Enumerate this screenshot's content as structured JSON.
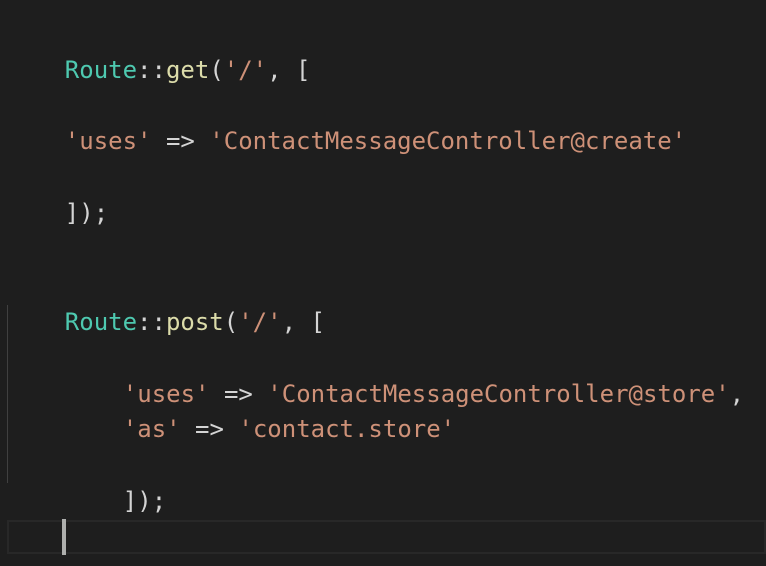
{
  "editor": {
    "lines": [
      {
        "class": "Route",
        "op": "::",
        "method": "get",
        "open": "(",
        "path": "'/'",
        "sep": ", ["
      },
      {
        "key": "'uses'",
        "arrow": " => ",
        "value": "'ContactMessageController@create'"
      },
      {
        "text": "]);"
      },
      {
        "class": "Route",
        "op": "::",
        "method": "post",
        "open": "(",
        "path": "'/'",
        "sep": ", ["
      },
      {
        "key": "'uses'",
        "arrow": " => ",
        "value": "'ContactMessageController@store'",
        "trail": ","
      },
      {
        "key": "'as'",
        "arrow": " => ",
        "value": "'contact.store'"
      },
      {
        "text": "]);"
      }
    ]
  },
  "colors": {
    "background": "#1e1e1e",
    "class": "#4ec9b0",
    "method": "#dcdcaa",
    "string": "#ce9178",
    "punctuation": "#d4d4d4"
  }
}
